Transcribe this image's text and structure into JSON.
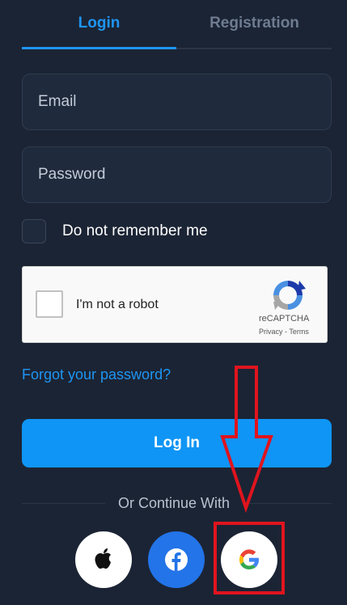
{
  "tabs": {
    "login": "Login",
    "registration": "Registration"
  },
  "form": {
    "email_placeholder": "Email",
    "password_placeholder": "Password",
    "remember_label": "Do not remember me",
    "forgot_link": "Forgot your password?",
    "login_button": "Log In"
  },
  "captcha": {
    "label": "I'm not a robot",
    "brand": "reCAPTCHA",
    "links": "Privacy - Terms"
  },
  "social": {
    "divider_text": "Or Continue With",
    "providers": [
      "apple-icon",
      "facebook-icon",
      "google-icon"
    ]
  },
  "colors": {
    "background": "#1b2434",
    "accent": "#1e95f3",
    "button": "#0f95f5",
    "highlight": "#e0141e"
  }
}
